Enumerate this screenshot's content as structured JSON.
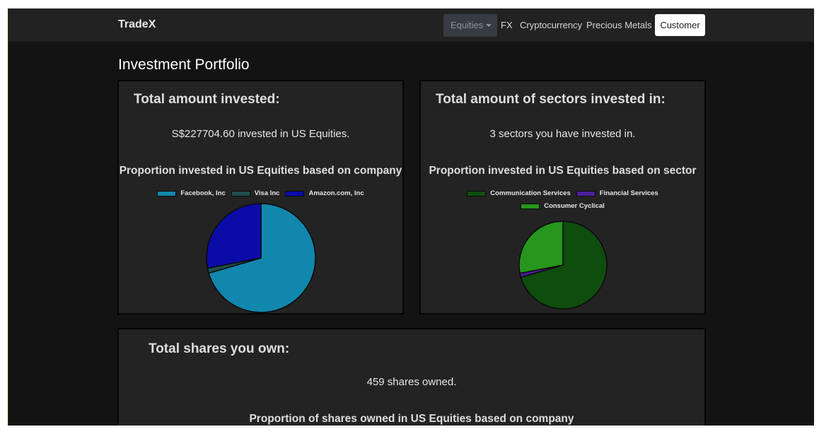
{
  "navbar": {
    "brand": "TradeX",
    "equities_label": "Equities",
    "fx_label": "FX",
    "crypto_label": "Cryptocurrency",
    "metals_label": "Precious Metals",
    "customer_label": "Customer"
  },
  "page_title": "Investment Portfolio",
  "invested_card": {
    "heading": "Total amount invested:",
    "summary": "S$227704.60 invested in US Equities."
  },
  "sectors_card": {
    "heading": "Total amount of sectors invested in:",
    "summary": "3 sectors you have invested in."
  },
  "shares_card": {
    "heading": "Total shares you own:",
    "summary": "459 shares owned.",
    "chart_title": "Proportion of shares owned in US Equities based on company"
  },
  "chart_data": [
    {
      "type": "pie",
      "title": "Proportion invested in US Equities based on company",
      "categories": [
        "Facebook, Inc",
        "Visa Inc",
        "Amazon.com, Inc"
      ],
      "values": [
        70.5,
        1.5,
        28.0
      ],
      "colors": [
        "#1187ad",
        "#1f4f4d",
        "#0b0ba8"
      ],
      "legend": "top"
    },
    {
      "type": "pie",
      "title": "Proportion invested in US Equities based on sector",
      "categories": [
        "Communication Services",
        "Financial Services",
        "Consumer Cyclical"
      ],
      "values": [
        70.5,
        1.5,
        28.0
      ],
      "colors": [
        "#0f4d0f",
        "#4b1f9c",
        "#26961c"
      ],
      "legend": "top"
    }
  ]
}
